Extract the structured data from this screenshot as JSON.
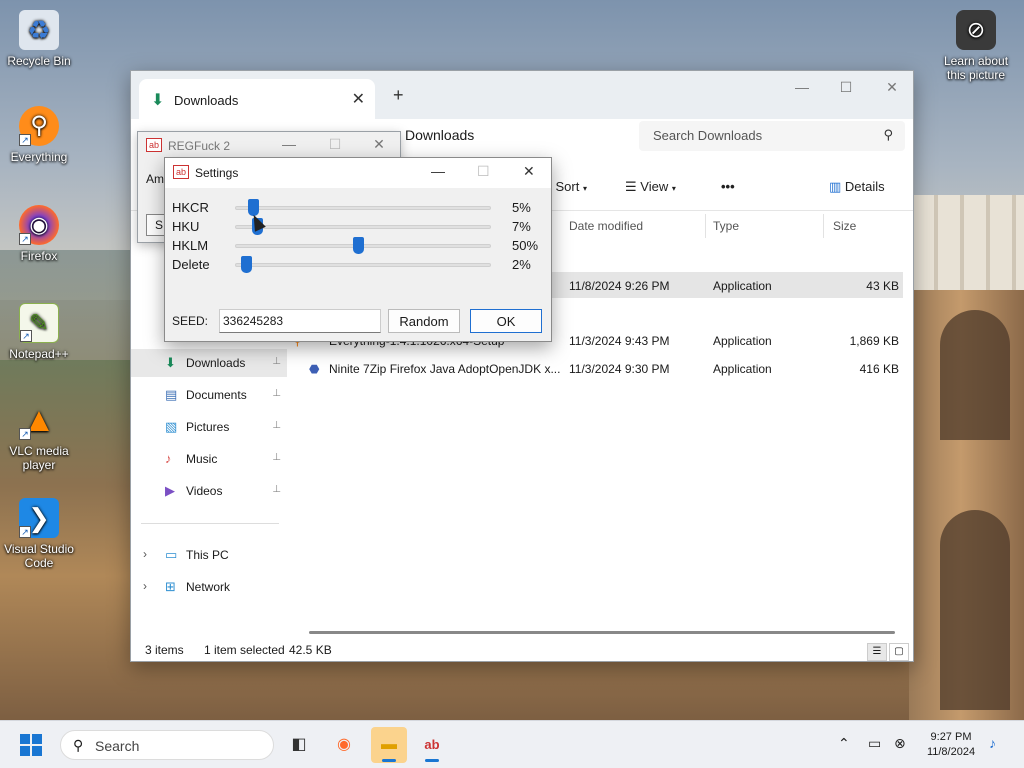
{
  "desktop": {
    "icons": [
      {
        "label": "Recycle Bin",
        "glyph": "♻",
        "color": "#cfd8e3"
      },
      {
        "label": "Everything",
        "glyph": "⚲",
        "color": "#ff8c1a"
      },
      {
        "label": "Firefox",
        "glyph": "◉",
        "color": "#ff6a2b"
      },
      {
        "label": "Notepad++",
        "glyph": "✎",
        "color": "#9fd36d"
      },
      {
        "label": "VLC media player",
        "glyph": "▲",
        "color": "#ff8800"
      },
      {
        "label": "Visual Studio Code",
        "glyph": "❯",
        "color": "#1e88e5"
      }
    ],
    "learn_about": "Learn about this picture"
  },
  "explorer": {
    "tab_label": "Downloads",
    "tab_close": "✕",
    "new_tab": "+",
    "min": "—",
    "max": "☐",
    "close": "✕",
    "path": "Downloads",
    "search_placeholder": "Search Downloads",
    "search_icon": "⚲",
    "toolbar": {
      "sort": "Sort",
      "view": "View",
      "more": "•••",
      "details": "Details"
    },
    "columns": {
      "date": "Date modified",
      "type": "Type",
      "size": "Size"
    },
    "files": [
      {
        "name": "",
        "date": "11/8/2024 9:26 PM",
        "type": "Application",
        "size": "43 KB",
        "selected": true
      },
      {
        "name": "Everything-1.4.1.1026.x64-Setup",
        "date": "11/3/2024 9:43 PM",
        "type": "Application",
        "size": "1,869 KB",
        "selected": false
      },
      {
        "name": "Ninite 7Zip Firefox Java AdoptOpenJDK x...",
        "date": "11/3/2024 9:30 PM",
        "type": "Application",
        "size": "416 KB",
        "selected": false
      }
    ],
    "nav": [
      {
        "label": "Downloads",
        "icon": "⬇",
        "color": "#1a8a5a",
        "pin": "📌"
      },
      {
        "label": "Documents",
        "icon": "▤",
        "color": "#3d6fb5",
        "pin": "📌"
      },
      {
        "label": "Pictures",
        "icon": "▧",
        "color": "#2f8fd1",
        "pin": "📌"
      },
      {
        "label": "Music",
        "icon": "♪",
        "color": "#d9534f",
        "pin": "📌"
      },
      {
        "label": "Videos",
        "icon": "▶",
        "color": "#7b4fc4",
        "pin": "📌"
      }
    ],
    "tree": [
      {
        "label": "This PC",
        "icon": "▭",
        "color": "#2f8fd1",
        "chev": "›"
      },
      {
        "label": "Network",
        "icon": "⊞",
        "color": "#2f8fd1",
        "chev": "›"
      }
    ],
    "status": {
      "items": "3 items",
      "selected": "1 item selected",
      "size": "42.5 KB"
    }
  },
  "regfuck": {
    "title": "REGFuck 2",
    "icon": "ab",
    "text": "Amo",
    "button": "S",
    "min": "—",
    "max": "☐",
    "close": "✕"
  },
  "settings": {
    "title": "Settings",
    "icon": "ab",
    "min": "—",
    "max": "☐",
    "close": "✕",
    "sliders": [
      {
        "label": "HKCR",
        "value": 5,
        "pct": "5%"
      },
      {
        "label": "HKU",
        "value": 7,
        "pct": "7%"
      },
      {
        "label": "HKLM",
        "value": 50,
        "pct": "50%"
      },
      {
        "label": "Delete",
        "value": 2,
        "pct": "2%"
      }
    ],
    "seed_label": "SEED:",
    "seed_value": "336245283",
    "random": "Random",
    "ok": "OK"
  },
  "taskbar": {
    "search": "Search",
    "search_icon": "⚲",
    "time": "9:27 PM",
    "date": "11/8/2024",
    "tray_up": "⌃",
    "tray_bell": "🔔"
  }
}
